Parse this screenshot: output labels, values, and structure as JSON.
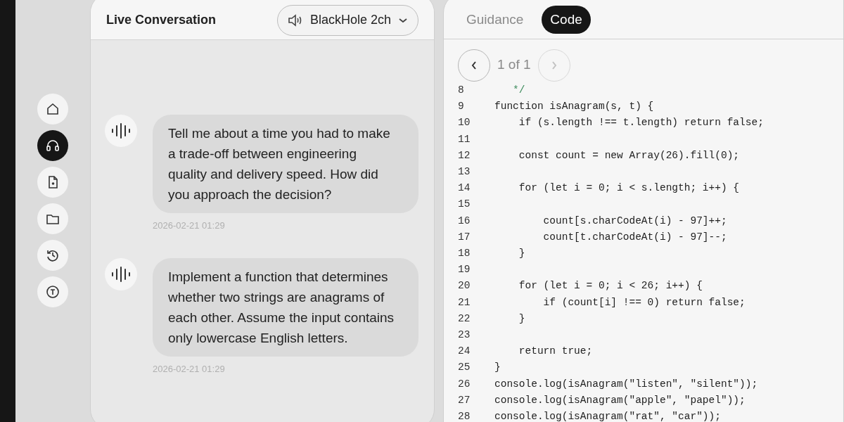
{
  "sidebar": {
    "items": [
      {
        "selected": false
      },
      {
        "selected": true
      },
      {
        "selected": false
      },
      {
        "selected": false
      },
      {
        "selected": false
      },
      {
        "selected": false
      }
    ]
  },
  "conversation": {
    "title": "Live Conversation",
    "audio_device": "BlackHole 2ch",
    "messages": [
      {
        "text": "Tell me about a time you had to make a trade-off between engineering quality and delivery speed. How did you approach the decision?",
        "time": "2026-02-21 01:29"
      },
      {
        "text": "Implement a function that determines whether two strings are anagrams of each other. Assume the input contains only lowercase English letters.",
        "time": "2026-02-21 01:29"
      }
    ]
  },
  "tabs": [
    {
      "label": "Guidance",
      "selected": false
    },
    {
      "label": "Code",
      "selected": true
    }
  ],
  "pager": {
    "label": "1 of 1",
    "prev_disabled": false,
    "next_disabled": true
  },
  "code_lines": [
    {
      "number": "8",
      "text": "   */",
      "kind": "comment"
    },
    {
      "number": "9",
      "text": "function isAnagram(s, t) {",
      "kind": "code"
    },
    {
      "number": "10",
      "text": "    if (s.length !== t.length) return false;",
      "kind": "code"
    },
    {
      "number": "11"
    },
    {
      "number": "12",
      "text": "    const count = new Array(26).fill(0);",
      "kind": "code"
    },
    {
      "number": "13"
    },
    {
      "number": "14",
      "text": "    for (let i = 0; i < s.length; i++) {",
      "kind": "code"
    },
    {
      "number": "15"
    },
    {
      "number": "16",
      "text": "        count[s.charCodeAt(i) - 97]++;",
      "kind": "code"
    },
    {
      "number": "17",
      "text": "        count[t.charCodeAt(i) - 97]--;",
      "kind": "code"
    },
    {
      "number": "18",
      "text": "    }",
      "kind": "code"
    },
    {
      "number": "19"
    },
    {
      "number": "20",
      "text": "    for (let i = 0; i < 26; i++) {",
      "kind": "code"
    },
    {
      "number": "21",
      "text": "        if (count[i] !== 0) return false;",
      "kind": "code"
    },
    {
      "number": "22",
      "text": "    }",
      "kind": "code"
    },
    {
      "number": "23"
    },
    {
      "number": "24",
      "text": "    return true;",
      "kind": "code"
    },
    {
      "number": "25",
      "text": "}",
      "kind": "code"
    },
    {
      "number": "26",
      "text": "console.log(isAnagram(\"listen\", \"silent\"));",
      "kind": "code"
    },
    {
      "number": "27",
      "text": "console.log(isAnagram(\"apple\", \"papel\"));",
      "kind": "code"
    },
    {
      "number": "28",
      "text": "console.log(isAnagram(\"rat\", \"car\"));",
      "kind": "code"
    }
  ]
}
